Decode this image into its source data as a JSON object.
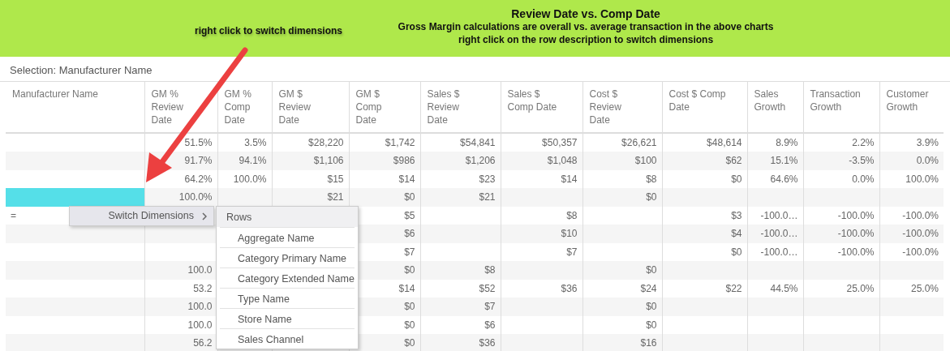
{
  "banner": {
    "hint": "right click to switch dimensions",
    "title": "Review Date vs. Comp Date",
    "lines": [
      "Gross Margin calculations are overall vs. average transaction in the above charts",
      "right click on the row description to switch dimensions"
    ]
  },
  "selection": "Selection: Manufacturer Name",
  "table": {
    "columns": [
      "Manufacturer Name",
      "GM % Review Date",
      "GM % Comp Date",
      "GM $ Review Date",
      "GM $ Comp Date",
      "Sales $ Review Date",
      "Sales $ Comp Date",
      "Cost $ Review Date",
      "Cost $ Comp Date",
      "Sales Growth",
      "Transaction Growth",
      "Customer Growth"
    ],
    "rows": [
      {
        "selected": false,
        "cells": [
          null,
          "51.5%",
          "3.5%",
          "$28,220",
          "$1,742",
          "$54,841",
          "$50,357",
          "$26,621",
          "$48,614",
          "8.9%",
          "2.2%",
          "3.9%"
        ]
      },
      {
        "selected": false,
        "cells": [
          null,
          "91.7%",
          "94.1%",
          "$1,106",
          "$986",
          "$1,206",
          "$1,048",
          "$100",
          "$62",
          "15.1%",
          "-3.5%",
          "0.0%"
        ]
      },
      {
        "selected": false,
        "cells": [
          null,
          "64.2%",
          "100.0%",
          "$15",
          "$14",
          "$23",
          "$14",
          "$8",
          "$0",
          "64.6%",
          "0.0%",
          "100.0%"
        ]
      },
      {
        "selected": true,
        "cells": [
          null,
          "100.0%",
          null,
          "$21",
          "$0",
          "$21",
          null,
          "$0",
          null,
          null,
          null,
          null
        ]
      },
      {
        "selected": false,
        "cells": [
          "=",
          null,
          null,
          null,
          "$5",
          null,
          "$8",
          null,
          "$3",
          "-100.0…",
          "-100.0%",
          "-100.0%"
        ]
      },
      {
        "selected": false,
        "cells": [
          null,
          null,
          null,
          null,
          "$6",
          null,
          "$10",
          null,
          "$4",
          "-100.0…",
          "-100.0%",
          "-100.0%"
        ]
      },
      {
        "selected": false,
        "cells": [
          null,
          null,
          null,
          null,
          "$7",
          null,
          "$7",
          null,
          "$0",
          "-100.0…",
          "-100.0%",
          "-100.0%"
        ]
      },
      {
        "selected": false,
        "cells": [
          null,
          "100.0",
          null,
          null,
          "$0",
          "$8",
          null,
          "$0",
          null,
          null,
          null,
          null
        ]
      },
      {
        "selected": false,
        "cells": [
          null,
          "53.2",
          null,
          null,
          "$14",
          "$52",
          "$36",
          "$24",
          "$22",
          "44.5%",
          "25.0%",
          "25.0%"
        ]
      },
      {
        "selected": false,
        "cells": [
          null,
          "100.0",
          null,
          null,
          "$0",
          "$7",
          null,
          "$0",
          null,
          null,
          null,
          null
        ]
      },
      {
        "selected": false,
        "cells": [
          null,
          "100.0",
          null,
          null,
          "$0",
          "$6",
          null,
          "$0",
          null,
          null,
          null,
          null
        ]
      },
      {
        "selected": false,
        "cells": [
          null,
          "56.2",
          null,
          null,
          "$0",
          "$36",
          null,
          "$16",
          null,
          null,
          null,
          null
        ]
      }
    ]
  },
  "context_menu": {
    "items": [
      {
        "label": "Switch Dimensions",
        "expanded": true
      }
    ],
    "submenu": {
      "header": "Rows",
      "items": [
        "Aggregate Name",
        "Category Primary Name",
        "Category Extended Name",
        "Type Name",
        "Store Name",
        "Sales Channel"
      ]
    }
  }
}
